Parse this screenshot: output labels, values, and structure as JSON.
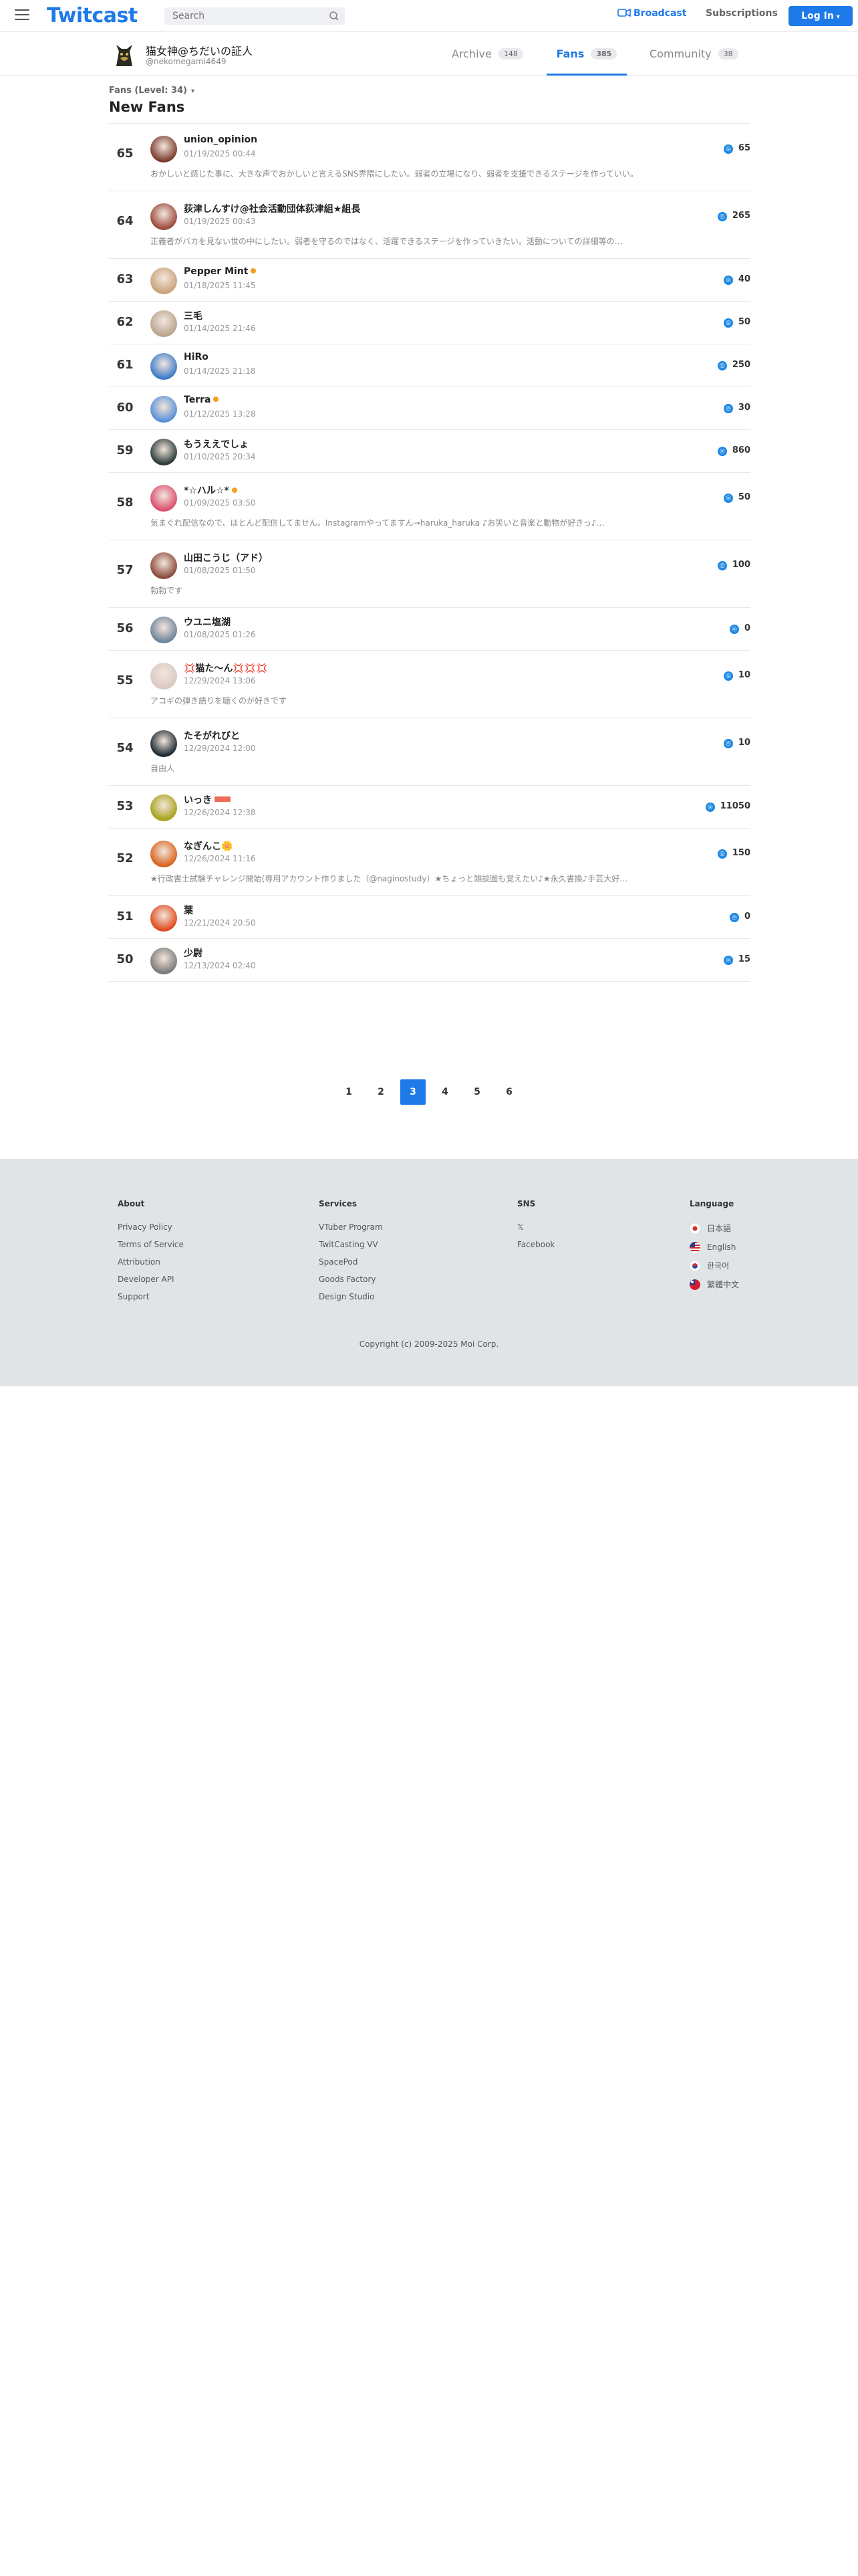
{
  "header": {
    "logo": "Twitcast",
    "search_placeholder": "Search",
    "broadcast": "Broadcast",
    "subscriptions": "Subscriptions",
    "login": "Log In"
  },
  "profile": {
    "name": "猫女神@ちだいの証人",
    "id": "@nekomegami4649",
    "tabs": [
      {
        "label": "Archive",
        "count": "148"
      },
      {
        "label": "Fans",
        "count": "385"
      },
      {
        "label": "Community",
        "count": "38"
      }
    ]
  },
  "main": {
    "filter": "Fans (Level: 34)",
    "title": "New Fans"
  },
  "fans": [
    {
      "rank": "65",
      "name": "union_opinion",
      "date": "01/19/2025 00:44",
      "bio": "おかしいと感じた事に、大きな声でおかしいと言えるSNS界隈にしたい。弱者の立場になり、弱者を支援できるステージを作っていい。",
      "score": "65",
      "avatar_color": "#7a3b2e"
    },
    {
      "rank": "64",
      "name": "荻津しんすけ@社会活動団体荻津組★組長",
      "date": "01/19/2025 00:43",
      "bio": "正義者がバカを見ない世の中にしたい。弱者を守るのではなく、活躍できるステージを作っていきたい。活動についての詳細等の…",
      "score": "265",
      "avatar_color": "#9c4a3c"
    },
    {
      "rank": "63",
      "name": "Pepper Mint",
      "date": "01/18/2025 11:45",
      "bio": "",
      "score": "40",
      "avatar_color": "#c9a37c"
    },
    {
      "rank": "62",
      "name": "三毛",
      "date": "01/14/2025 21:46",
      "bio": "",
      "score": "50",
      "avatar_color": "#b8a58f"
    },
    {
      "rank": "61",
      "name": "HiRo",
      "date": "01/14/2025 21:18",
      "bio": "",
      "score": "250",
      "avatar_color": "#3d7cc9"
    },
    {
      "rank": "60",
      "name": "Terra",
      "date": "01/12/2025 13:28",
      "bio": "",
      "score": "30",
      "avatar_color": "#5a8fd6"
    },
    {
      "rank": "59",
      "name": "もうええでしょ",
      "date": "01/10/2025 20:34",
      "bio": "",
      "score": "860",
      "avatar_color": "#2c3a3a"
    },
    {
      "rank": "58",
      "name": "*☆ハル☆*",
      "date": "01/09/2025 03:50",
      "bio": "気まぐれ配信なので、ほとんど配信してません。Instagramやってますん→haruka_haruka ♪お笑いと音楽と動物が好きっ♪…",
      "score": "50",
      "avatar_color": "#d94f6f"
    },
    {
      "rank": "57",
      "name": "山田こうじ（アド）",
      "date": "01/08/2025 01:50",
      "bio": "勃勃です",
      "score": "100",
      "avatar_color": "#8a4a3a"
    },
    {
      "rank": "56",
      "name": "ウユニ塩湖",
      "date": "01/08/2025 01:26",
      "bio": "",
      "score": "0",
      "avatar_color": "#6d8499"
    },
    {
      "rank": "55",
      "name": "💢猫た〜ん💢💢💢",
      "date": "12/29/2024 13:06",
      "bio": "アコギの弾き語りを聴くのが好きです",
      "score": "10",
      "avatar_color": "#d9c9c4"
    },
    {
      "rank": "54",
      "name": "たそがれびと",
      "date": "12/29/2024 12:00",
      "bio": "自由人",
      "score": "10",
      "avatar_color": "#1c2a33"
    },
    {
      "rank": "53",
      "name": "いっき",
      "date": "12/26/2024 12:38",
      "bio": "",
      "score": "11050",
      "avatar_color": "#a8a21a"
    },
    {
      "rank": "52",
      "name": "なぎんこ🌼",
      "date": "12/26/2024 11:16",
      "bio": "★行政書士試験チャレンジ開始(専用アカウント作りました（@naginostudy）★ちょっと雑談圏も覚えたい♪★永久書換♪手芸大好…",
      "score": "150",
      "avatar_color": "#d9641e"
    },
    {
      "rank": "51",
      "name": "葉",
      "date": "12/21/2024 20:50",
      "bio": "",
      "score": "0",
      "avatar_color": "#e04a1e"
    },
    {
      "rank": "50",
      "name": "少尉",
      "date": "12/13/2024 02:40",
      "bio": "",
      "score": "15",
      "avatar_color": "#7a7a7a"
    }
  ],
  "pagination": [
    "1",
    "2",
    "3",
    "4",
    "5",
    "6"
  ],
  "pagination_active": "3",
  "footer": {
    "about": {
      "title": "About",
      "links": [
        "Privacy Policy",
        "Terms of Service",
        "Attribution",
        "Developer API",
        "Support"
      ]
    },
    "services": {
      "title": "Services",
      "links": [
        "VTuber Program",
        "TwitCasting VV",
        "SpacePod",
        "Goods Factory",
        "Design Studio"
      ]
    },
    "sns": {
      "title": "SNS",
      "links": [
        "𝕏",
        "Facebook"
      ]
    },
    "language": {
      "title": "Language",
      "links": [
        "日本語",
        "English",
        "한국어",
        "繁體中文"
      ]
    },
    "copyright": "Copyright (c) 2009-2025 Moi Corp."
  },
  "colors": {
    "accent": "#1e7ae8",
    "coin": "#1e88e5",
    "footer_bg": "#e1e4e7"
  }
}
